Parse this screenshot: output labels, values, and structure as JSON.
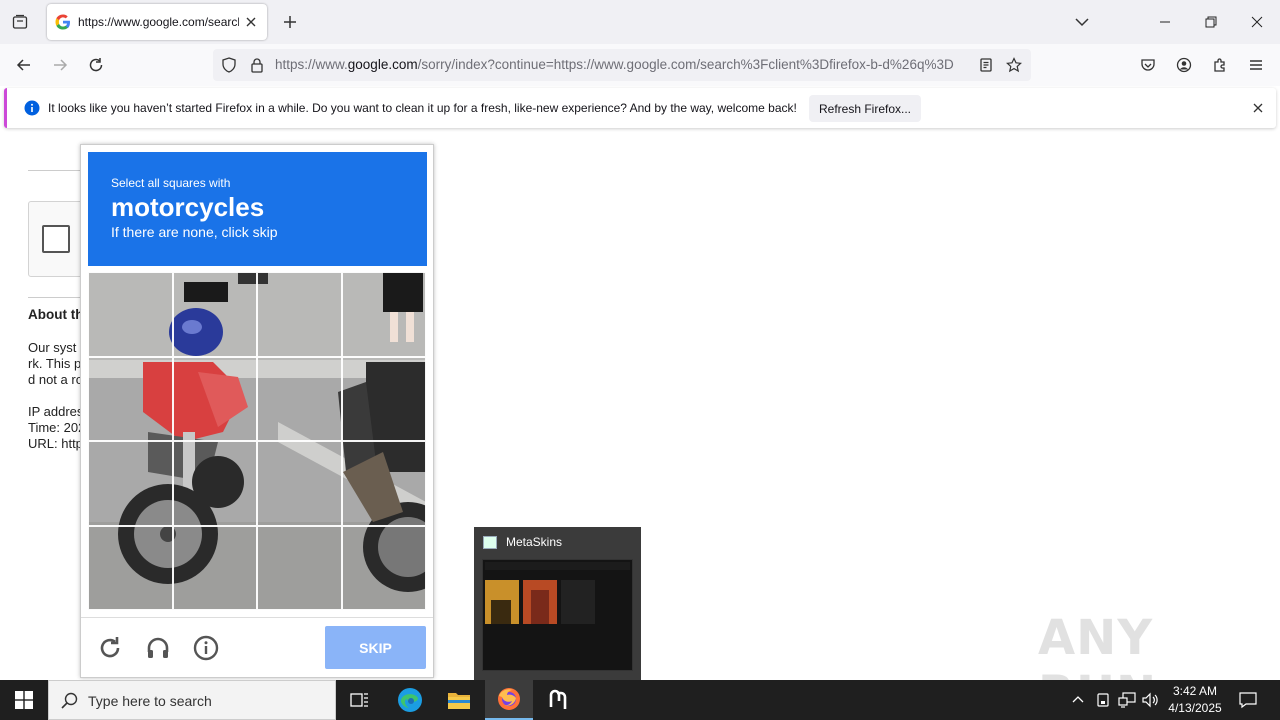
{
  "browser": {
    "tab_title": "https://www.google.com/search?client=firefox",
    "url_domain_prefix": "https://www.",
    "url_domain": "google.com",
    "url_rest": "/sorry/index?continue=https://www.google.com/search%3Fclient%3Dfirefox-b-d%26q%3D"
  },
  "notification": {
    "message": "It looks like you haven’t started Firefox in a while. Do you want to clean it up for a fresh, like-new experience? And by the way, welcome back!",
    "button_label": "Refresh Firefox..."
  },
  "page": {
    "about_heading": "About th",
    "lines": [
      "Our syst",
      "rk. This p",
      "d not a ro",
      "IP addres",
      "Time: 202",
      "URL: http"
    ]
  },
  "challenge": {
    "instruction": "Select all squares with",
    "target": "motorcycles",
    "hint": "If there are none, click skip",
    "skip_label": "SKIP",
    "accent_color": "#1a73e8",
    "skip_color": "#8ab4f8"
  },
  "thumbnail": {
    "title": "MetaSkins"
  },
  "watermark": "ANY RUN",
  "taskbar": {
    "search_placeholder": "Type here to search",
    "time": "3:42 AM",
    "date": "4/13/2025"
  }
}
